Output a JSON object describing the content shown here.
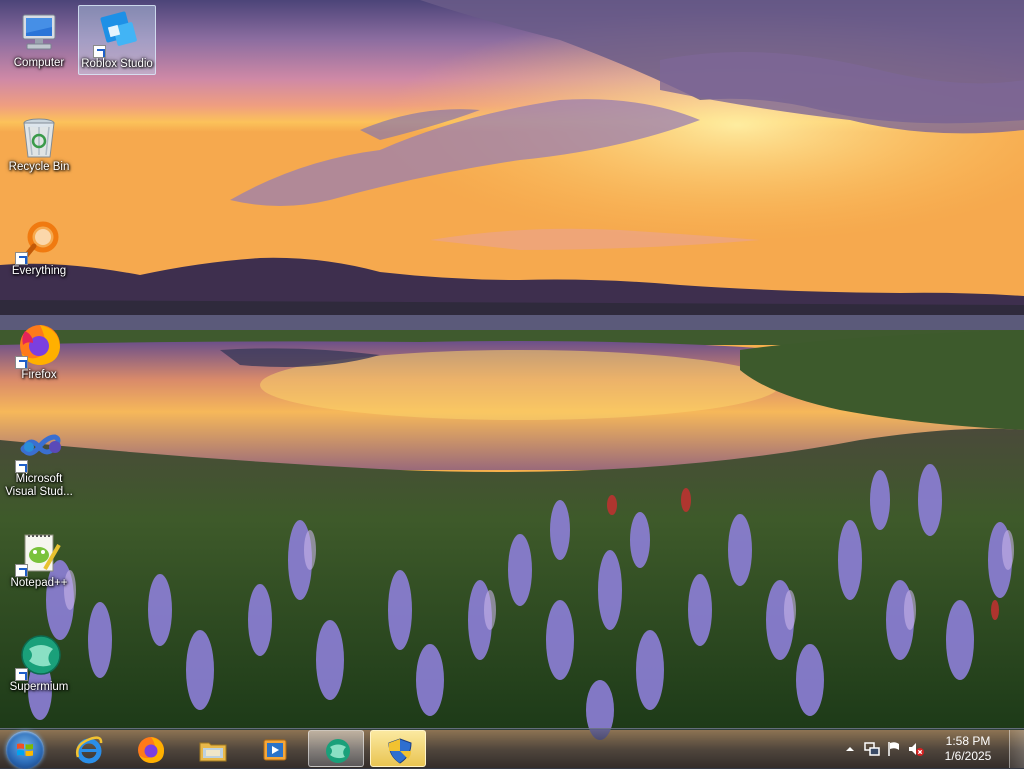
{
  "desktop": {
    "icons": [
      {
        "label": "Computer",
        "icon": "computer-icon",
        "shortcut": false,
        "selected": false
      },
      {
        "label": "Roblox Studio",
        "icon": "roblox-studio-icon",
        "shortcut": true,
        "selected": true
      },
      {
        "label": "Recycle Bin",
        "icon": "recycle-bin-icon",
        "shortcut": false,
        "selected": false
      },
      {
        "label": "Everything",
        "icon": "everything-search-icon",
        "shortcut": true,
        "selected": false
      },
      {
        "label": "Firefox",
        "icon": "firefox-icon",
        "shortcut": true,
        "selected": false
      },
      {
        "label": "Microsoft Visual Stud...",
        "icon": "visual-studio-icon",
        "shortcut": true,
        "selected": false
      },
      {
        "label": "Notepad++",
        "icon": "notepad-plus-plus-icon",
        "shortcut": true,
        "selected": false
      },
      {
        "label": "Supermium",
        "icon": "supermium-icon",
        "shortcut": true,
        "selected": false
      }
    ]
  },
  "taskbar": {
    "start_icon": "windows-start-orb-icon",
    "pinned": [
      {
        "name": "internet-explorer",
        "icon": "internet-explorer-icon",
        "state": "normal"
      },
      {
        "name": "firefox",
        "icon": "firefox-icon",
        "state": "normal"
      },
      {
        "name": "windows-explorer",
        "icon": "file-explorer-icon",
        "state": "normal"
      },
      {
        "name": "media-player",
        "icon": "media-player-icon",
        "state": "normal"
      },
      {
        "name": "supermium",
        "icon": "supermium-icon",
        "state": "active"
      },
      {
        "name": "uac-shield",
        "icon": "uac-shield-icon",
        "state": "highlighted"
      }
    ],
    "tray": {
      "icons": [
        "show-hidden-icons-arrow",
        "network-icon",
        "action-center-flag-icon",
        "volume-muted-icon"
      ],
      "time": "1:58 PM",
      "date": "1/6/2025"
    }
  },
  "colors": {
    "taskbar_bg": "#1a2236",
    "selection": "#bed7f0",
    "label_text": "#ffffff"
  }
}
